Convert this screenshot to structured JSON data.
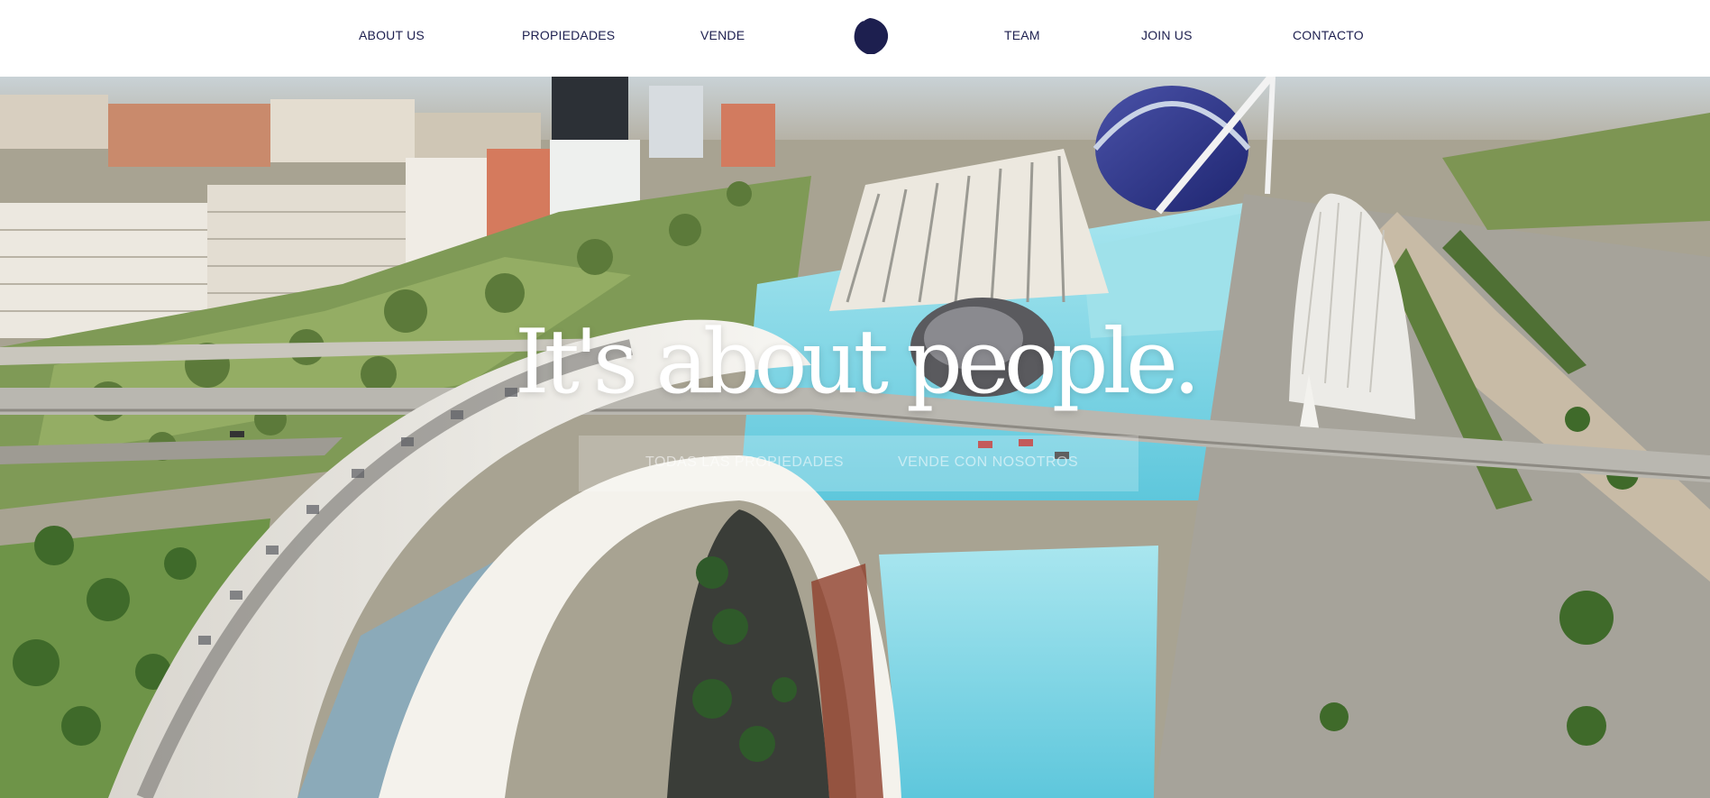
{
  "nav": {
    "left_links": [
      "ABOUT US",
      "PROPIEDADES",
      "VENDE"
    ],
    "right_links": [
      "TEAM",
      "JOIN US",
      "CONTACTO"
    ],
    "logo_icon": "lion-head-logo-icon"
  },
  "hero": {
    "headline": "It's about people.",
    "cta_primary": "TODAS LAS PROPIEDADES",
    "cta_secondary": "VENDE CON NOSOTROS",
    "background": "aerial-city-arts-and-sciences-image"
  },
  "colors": {
    "nav_text": "#1d1f4f",
    "water": "#7fd3e3",
    "structure_white": "#f2f0ea"
  }
}
